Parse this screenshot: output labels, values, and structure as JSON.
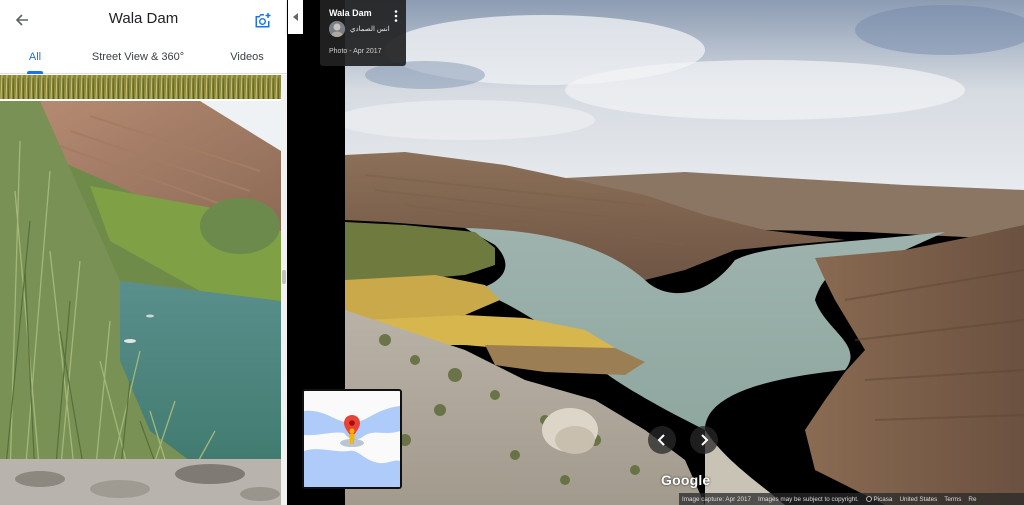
{
  "header": {
    "title": "Wala Dam",
    "back_icon": "arrow-back-icon",
    "add_photo_icon": "add-photo-camera-icon",
    "accent_color": "#1a73e8"
  },
  "tabs": [
    {
      "label": "All",
      "active": true
    },
    {
      "label": "Street View & 360°",
      "active": false
    },
    {
      "label": "Videos",
      "active": false
    }
  ],
  "info_card": {
    "place_name": "Wala Dam",
    "author": "انس الصمادي",
    "photo_date": "Photo - Apr 2017",
    "menu_icon": "more-vert-icon"
  },
  "navigation": {
    "prev_icon": "chevron-left-icon",
    "next_icon": "chevron-right-icon",
    "collapse_icon": "triangle-left-icon"
  },
  "brand": {
    "logo_text": "Google"
  },
  "footer": {
    "capture": "Image capture: Apr 2017",
    "copyright": "Images may be subject to copyright.",
    "picasa": "Picasa",
    "country": "United States",
    "terms": "Terms",
    "report": "Re"
  }
}
